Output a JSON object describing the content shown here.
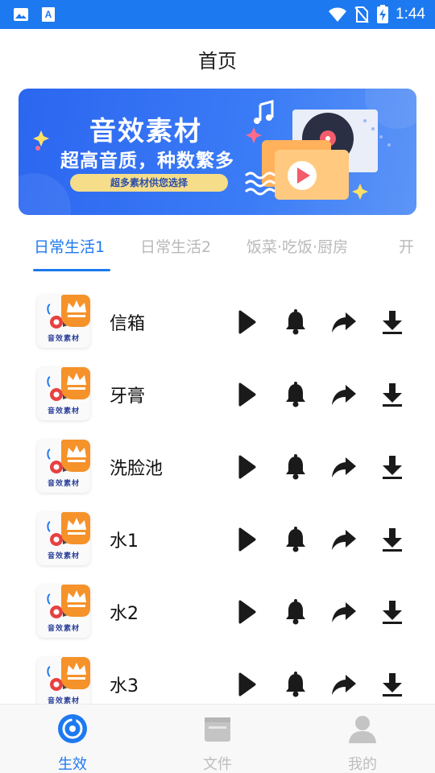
{
  "status_bar": {
    "time": "1:44",
    "icons": [
      "image-icon",
      "font-a-icon",
      "wifi-icon",
      "no-sim-icon",
      "battery-charging-icon"
    ]
  },
  "header": {
    "title": "首页"
  },
  "banner": {
    "title": "音效素材",
    "subtitle": "超高音质，种数繁多",
    "pill": "超多素材供您选择"
  },
  "tabs": [
    {
      "label": "日常生活1",
      "active": true
    },
    {
      "label": "日常生活2",
      "active": false
    },
    {
      "label": "饭菜·吃饭·厨房",
      "active": false
    },
    {
      "label": "开",
      "active": false
    }
  ],
  "items": [
    {
      "title": "信箱",
      "thumb_caption": "音效素材"
    },
    {
      "title": "牙膏",
      "thumb_caption": "音效素材"
    },
    {
      "title": "洗脸池",
      "thumb_caption": "音效素材"
    },
    {
      "title": "水1",
      "thumb_caption": "音效素材"
    },
    {
      "title": "水2",
      "thumb_caption": "音效素材"
    },
    {
      "title": "水3",
      "thumb_caption": "音效素材"
    }
  ],
  "row_actions": [
    "play-icon",
    "bell-icon",
    "share-icon",
    "download-icon"
  ],
  "bottom_nav": [
    {
      "label": "生效",
      "icon": "disc-icon",
      "active": true
    },
    {
      "label": "文件",
      "icon": "folder-icon",
      "active": false
    },
    {
      "label": "我的",
      "icon": "user-icon",
      "active": false
    }
  ],
  "colors": {
    "accent": "#1d79f0",
    "crown": "#f5922a",
    "icon": "#1a1a1a",
    "inactive": "#bdbdbd"
  }
}
